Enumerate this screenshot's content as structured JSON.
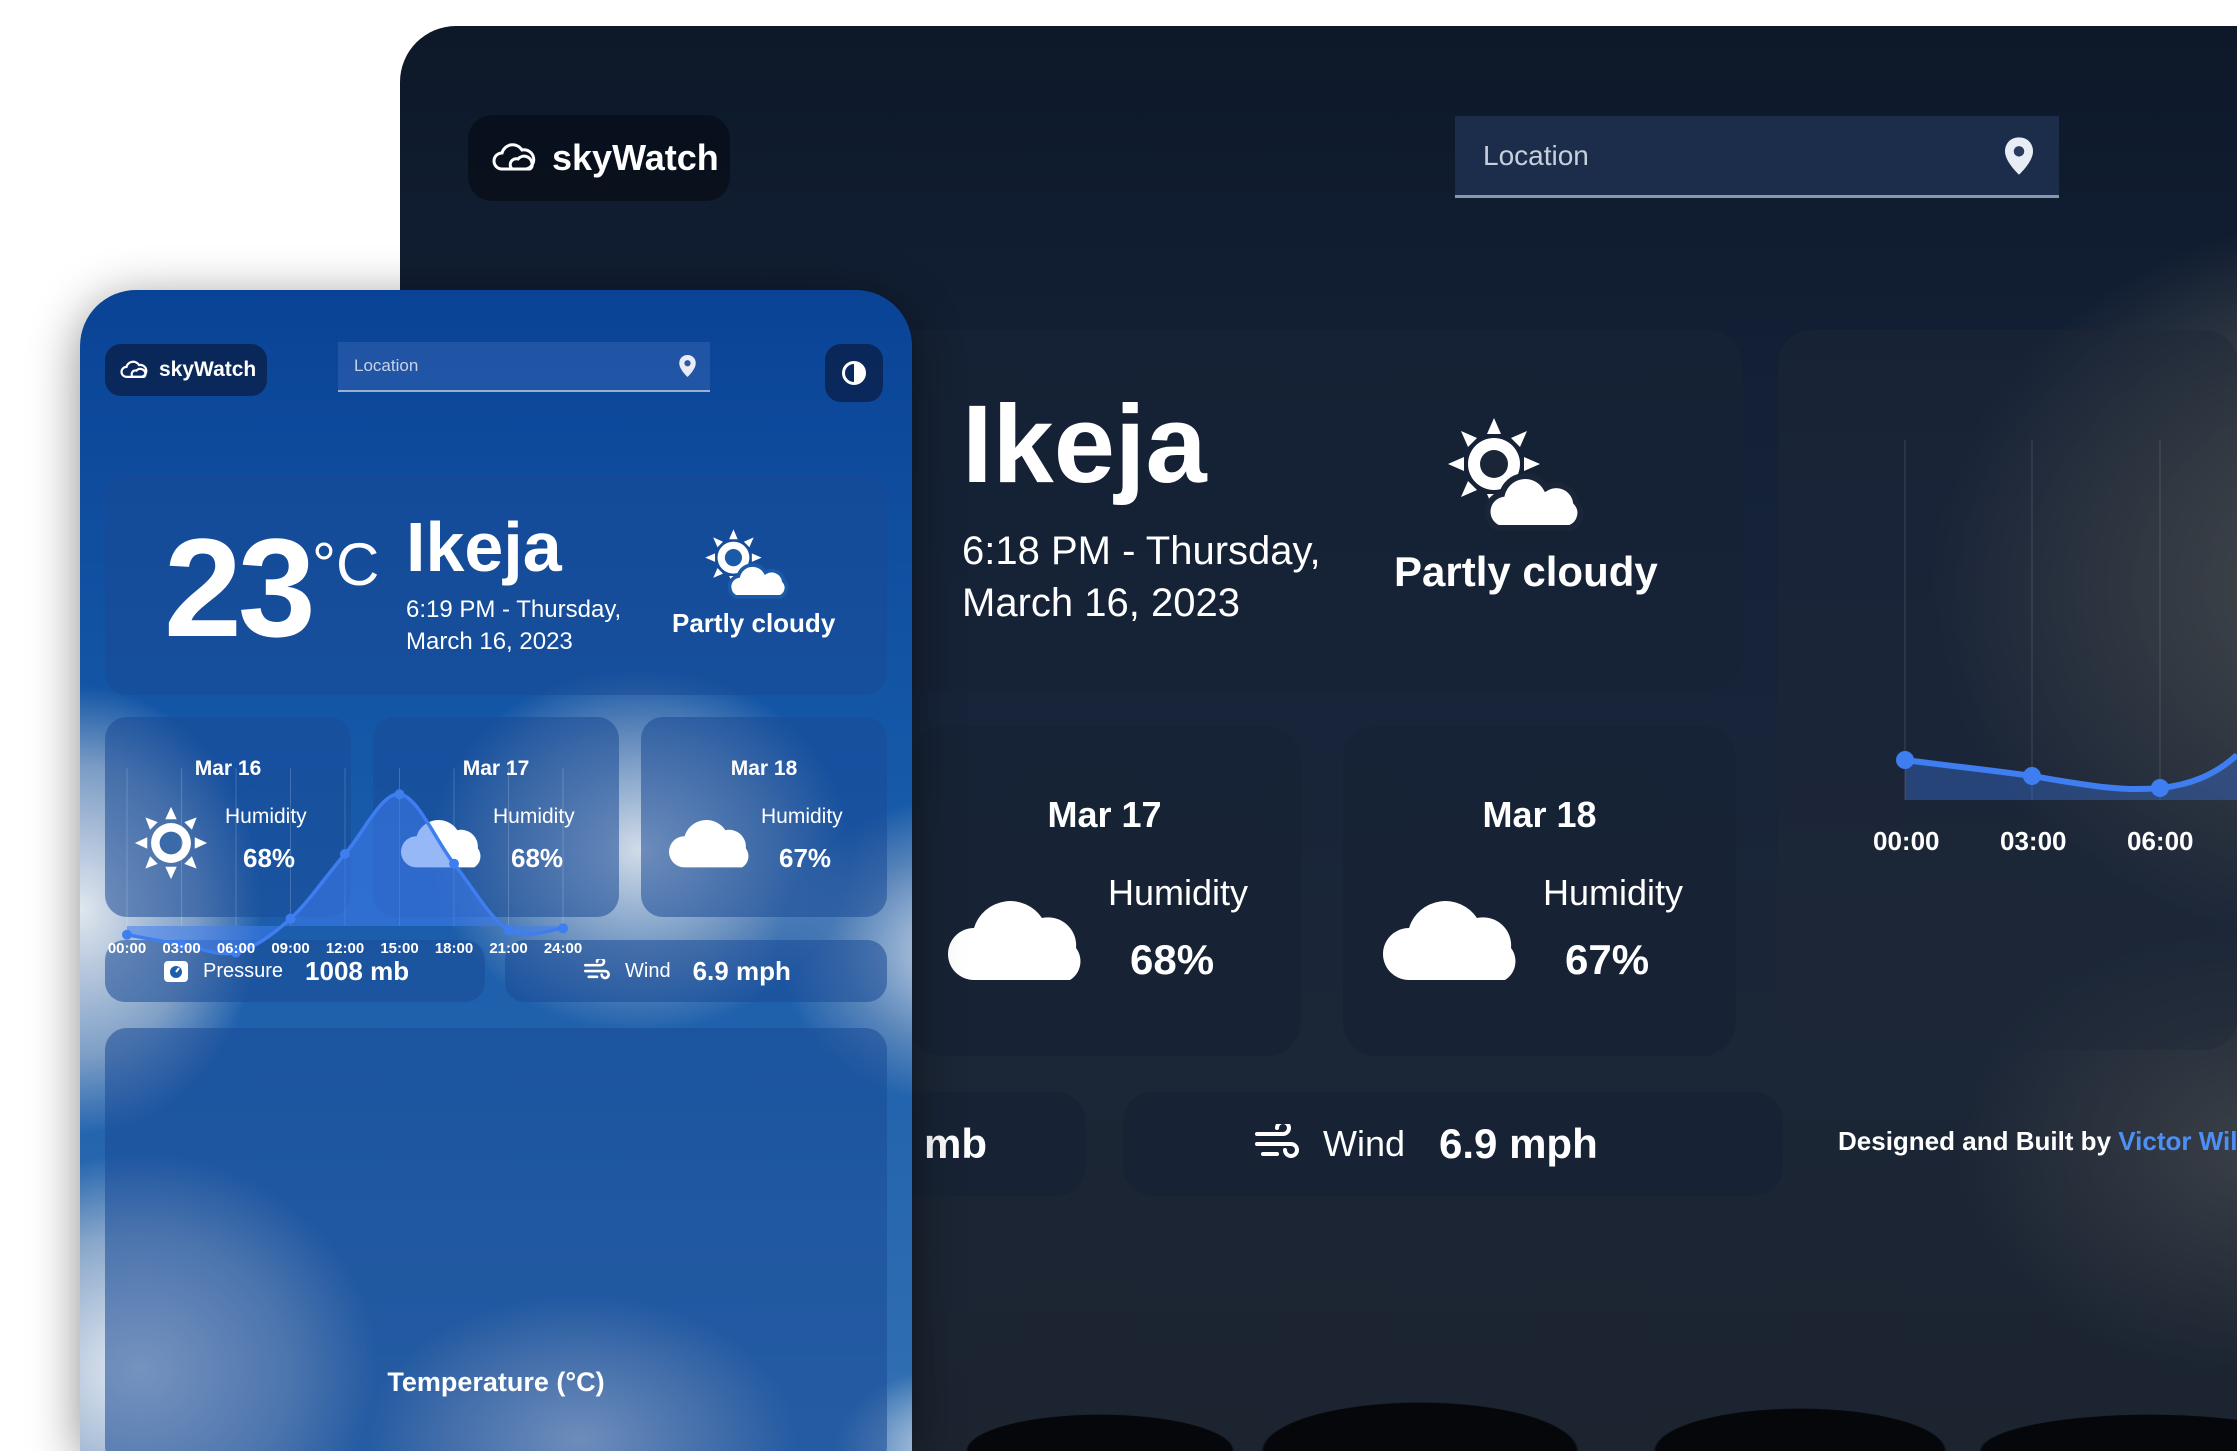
{
  "app_name": "skyWatch",
  "search": {
    "placeholder": "Location"
  },
  "current": {
    "temperature": "23",
    "unit": "°C",
    "city": "Ikeja",
    "tablet_datetime": "6:19 PM - Thursday, March 16, 2023",
    "desktop_datetime": "6:18 PM - Thursday, March 16, 2023",
    "condition": "Partly cloudy"
  },
  "forecast": [
    {
      "date": "Mar 16",
      "humidity_label": "Humidity",
      "humidity": "68%",
      "icon": "sun-icon"
    },
    {
      "date": "Mar 17",
      "humidity_label": "Humidity",
      "humidity": "68%",
      "icon": "cloud-icon"
    },
    {
      "date": "Mar 18",
      "humidity_label": "Humidity",
      "humidity": "67%",
      "icon": "cloud-icon"
    }
  ],
  "pressure": {
    "label": "Pressure",
    "value": "1008 mb",
    "desktop_value": "mb"
  },
  "wind": {
    "label": "Wind",
    "value": "6.9 mph"
  },
  "credit": {
    "prefix": "Designed and Built by",
    "author": "Victor Willi"
  },
  "desktop_times": [
    "00:00",
    "03:00",
    "06:00"
  ],
  "colors": {
    "accent": "#3f7ef0",
    "tablet_bg": "#1558a8",
    "desktop_bg": "#15223a"
  },
  "chart_data": {
    "type": "area",
    "title": "Temperature (°C)",
    "x": [
      "00:00",
      "03:00",
      "06:00",
      "09:00",
      "12:00",
      "15:00",
      "18:00",
      "21:00",
      "24:00"
    ],
    "values": [
      23.8,
      23.2,
      22.7,
      24.8,
      28.8,
      32.5,
      28.2,
      24.1,
      24.2
    ],
    "ylim": [
      21,
      34
    ],
    "grid": true
  }
}
